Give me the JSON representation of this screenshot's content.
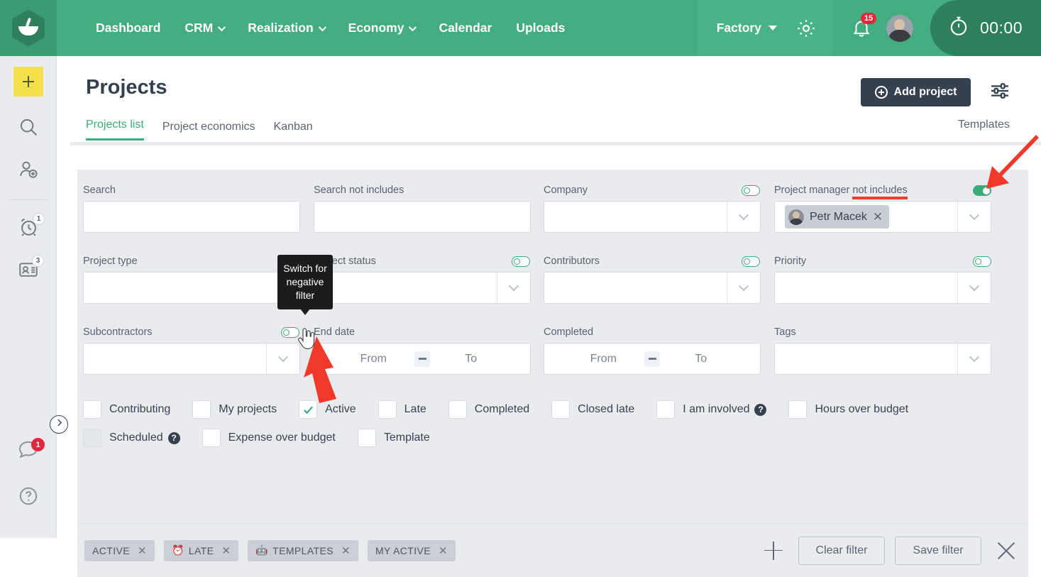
{
  "header": {
    "logo_icon": "app-logo-icon",
    "nav": [
      {
        "label": "Dashboard",
        "has_caret": false
      },
      {
        "label": "CRM",
        "has_caret": true
      },
      {
        "label": "Realization",
        "has_caret": true
      },
      {
        "label": "Economy",
        "has_caret": true
      },
      {
        "label": "Calendar",
        "has_caret": false
      },
      {
        "label": "Uploads",
        "has_caret": false
      }
    ],
    "workspace": "Factory",
    "gear_icon": "gear-icon",
    "bell_icon": "bell-icon",
    "notifications_count": "15",
    "avatar_icon": "user-avatar",
    "timer_icon": "stopwatch-icon",
    "timer_value": "00:00",
    "accent_green": "#44ad7f",
    "dark_green": "#2e7f5c"
  },
  "sidebar": {
    "add_icon": "plus-icon",
    "items": [
      {
        "icon": "search-icon",
        "badge": ""
      },
      {
        "icon": "add-user-icon",
        "badge": ""
      },
      {
        "icon": "alarm-clock-icon",
        "badge": "1"
      },
      {
        "icon": "contact-card-icon",
        "badge": "3"
      }
    ],
    "bottom": [
      {
        "icon": "chat-bubble-icon",
        "badge": "1"
      },
      {
        "icon": "help-circle-icon",
        "badge": ""
      }
    ],
    "expand_icon": "chevron-right-icon"
  },
  "page": {
    "title": "Projects",
    "add_button": "Add project",
    "add_button_icon": "plus-circle-icon",
    "settings_icon": "sliders-icon",
    "templates_link": "Templates",
    "tabs": [
      {
        "label": "Projects list",
        "active": true
      },
      {
        "label": "Project economics",
        "active": false
      },
      {
        "label": "Kanban",
        "active": false
      }
    ]
  },
  "filters": {
    "search": {
      "label": "Search",
      "value": "",
      "placeholder": ""
    },
    "search_not_includes": {
      "label": "Search not includes",
      "value": "",
      "placeholder": ""
    },
    "company": {
      "label": "Company",
      "value": "",
      "toggle": "off"
    },
    "project_manager": {
      "label_main": "Project manager ",
      "label_negative": "not includes",
      "toggle": "on",
      "chip_name": "Petr Macek",
      "chip_remove_icon": "close-icon"
    },
    "project_type": {
      "label": "Project type",
      "value": ""
    },
    "project_status": {
      "label": "Project status",
      "value": "",
      "toggle": "off"
    },
    "contributors": {
      "label": "Contributors",
      "value": "",
      "toggle": "off"
    },
    "priority": {
      "label": "Priority",
      "value": "",
      "toggle": "off"
    },
    "subcontractors": {
      "label": "Subcontractors",
      "value": "",
      "toggle": "off"
    },
    "end_date": {
      "label": "End date",
      "from": "From",
      "to": "To",
      "separator": "–"
    },
    "completed": {
      "label": "Completed",
      "from": "From",
      "to": "To",
      "separator": "–"
    },
    "tags": {
      "label": "Tags",
      "value": ""
    },
    "checkboxes_row1": [
      {
        "label": "Contributing",
        "checked": false,
        "disabled": false,
        "help": false
      },
      {
        "label": "My projects",
        "checked": false,
        "disabled": false,
        "help": false
      },
      {
        "label": "Active",
        "checked": true,
        "disabled": false,
        "help": false
      },
      {
        "label": "Late",
        "checked": false,
        "disabled": false,
        "help": false
      },
      {
        "label": "Completed",
        "checked": false,
        "disabled": false,
        "help": false
      },
      {
        "label": "Closed late",
        "checked": false,
        "disabled": false,
        "help": false
      },
      {
        "label": "I am involved",
        "checked": false,
        "disabled": false,
        "help": true
      },
      {
        "label": "Hours over budget",
        "checked": false,
        "disabled": false,
        "help": false
      }
    ],
    "checkboxes_row2": [
      {
        "label": "Scheduled",
        "checked": false,
        "disabled": true,
        "help": true
      },
      {
        "label": "Expense over budget",
        "checked": false,
        "disabled": false,
        "help": false
      },
      {
        "label": "Template",
        "checked": false,
        "disabled": false,
        "help": false
      }
    ],
    "saved_filters": [
      {
        "emoji": "",
        "label": "ACTIVE"
      },
      {
        "emoji": "⏰",
        "label": "LATE"
      },
      {
        "emoji": "🤖",
        "label": "TEMPLATES"
      },
      {
        "emoji": "",
        "label": "MY ACTIVE"
      }
    ],
    "footer": {
      "add_icon": "plus-icon",
      "clear_button": "Clear filter",
      "save_button": "Save filter",
      "close_icon": "close-icon"
    }
  },
  "tooltip": {
    "text": "Switch for negative filter"
  },
  "annotations": {
    "arrow_color": "#f0392b",
    "cursor_icon": "pointer-hand-cursor"
  }
}
